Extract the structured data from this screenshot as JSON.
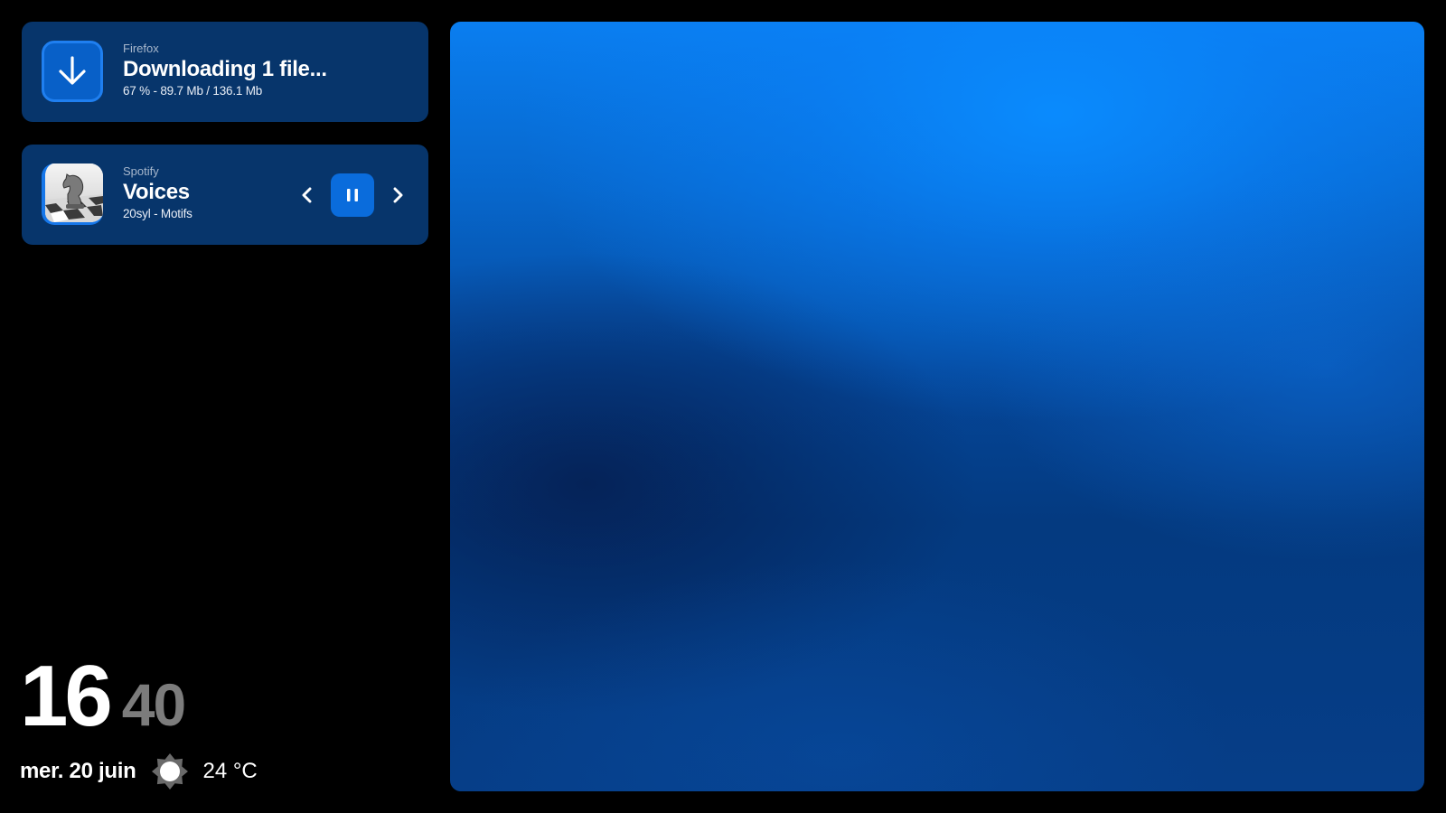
{
  "download_notification": {
    "app_name": "Firefox",
    "title": "Downloading 1 file...",
    "details": "67 % - 89.7 Mb / 136.1 Mb",
    "icon": "download-arrow-icon",
    "progress_percent": 67
  },
  "media_notification": {
    "app_name": "Spotify",
    "title": "Voices",
    "artist_album": "20syl - Motifs",
    "album_art": "chess-knight-album-art",
    "controls": {
      "previous_icon": "chevron-left-icon",
      "play_pause_icon": "pause-icon",
      "next_icon": "chevron-right-icon"
    }
  },
  "clock": {
    "hours": "16",
    "minutes": "40"
  },
  "status": {
    "date": "mer. 20 juin",
    "weather_icon": "sun-icon",
    "temperature": "24 °C"
  },
  "colors": {
    "background": "#000000",
    "card": "#07356b",
    "accent": "#0a6cdc",
    "minutes_gray": "#7c7c7c",
    "wallpaper_top": "#0a7ef0",
    "wallpaper_bottom": "#063e88"
  }
}
